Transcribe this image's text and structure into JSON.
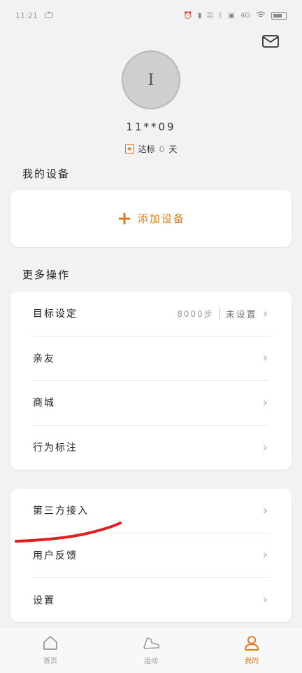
{
  "status": {
    "time": "11:21",
    "network": "4G"
  },
  "profile": {
    "avatar_text": "I",
    "username": "11**09",
    "streak_label": "达标",
    "streak_value": "0",
    "streak_unit": "天"
  },
  "devices": {
    "title": "我的设备",
    "add_label": "添加设备"
  },
  "more": {
    "title": "更多操作",
    "goal_label": "目标设定",
    "goal_steps": "8000步",
    "goal_status": "未设置",
    "friends_label": "亲友",
    "mall_label": "商城",
    "behavior_label": "行为标注"
  },
  "settings_card": {
    "third_party_label": "第三方接入",
    "feedback_label": "用户反馈",
    "settings_label": "设置"
  },
  "tabs": {
    "home": "首页",
    "sport": "运动",
    "mine": "我的"
  },
  "colors": {
    "accent": "#e07a1f",
    "annotation": "#e02020"
  }
}
